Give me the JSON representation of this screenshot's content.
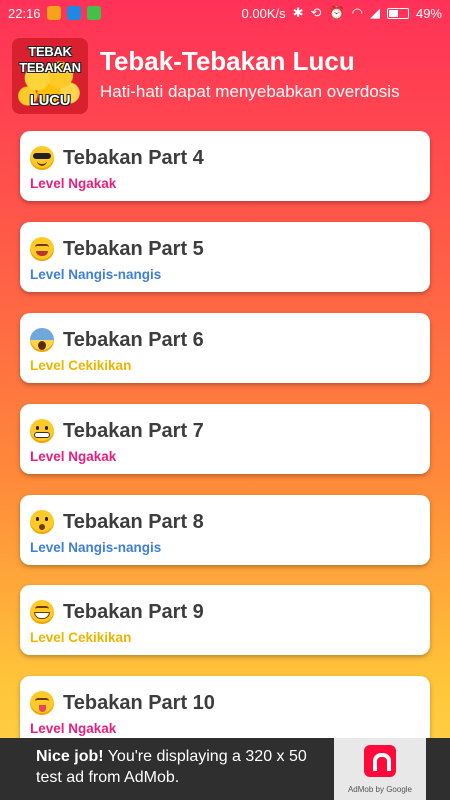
{
  "status_bar": {
    "time": "22:16",
    "speed": "0.00K/s",
    "battery": "49%",
    "left_icons": [
      "orange-app-icon",
      "shield-app-icon",
      "android-app-icon"
    ],
    "right_icons": [
      "bluetooth-icon",
      "sync-off-icon",
      "alarm-icon",
      "wifi-icon",
      "signal-icon",
      "battery-icon"
    ]
  },
  "header": {
    "logo_lines": [
      "TEBAK",
      "TEBAKAN",
      "LUCU"
    ],
    "title": "Tebak-Tebakan Lucu",
    "subtitle": "Hati-hati dapat menyebabkan overdosis"
  },
  "items": [
    {
      "title": "Tebakan Part 4",
      "level": "Level Ngakak",
      "level_color": "#e8207c",
      "emoji": "cool-face-icon"
    },
    {
      "title": "Tebakan Part 5",
      "level": "Level Nangis-nangis",
      "level_color": "#3f7fd9",
      "emoji": "smiling-face-icon"
    },
    {
      "title": "Tebakan Part 6",
      "level": "Level Cekikikan",
      "level_color": "#f0b400",
      "emoji": "screaming-face-icon"
    },
    {
      "title": "Tebakan Part 7",
      "level": "Level Ngakak",
      "level_color": "#e8207c",
      "emoji": "grimacing-face-icon"
    },
    {
      "title": "Tebakan Part 8",
      "level": "Level Nangis-nangis",
      "level_color": "#3f7fd9",
      "emoji": "surprised-face-icon"
    },
    {
      "title": "Tebakan Part 9",
      "level": "Level Cekikikan",
      "level_color": "#f0b400",
      "emoji": "grinning-face-icon"
    },
    {
      "title": "Tebakan Part 10",
      "level": "Level Ngakak",
      "level_color": "#e8207c",
      "emoji": "tongue-face-icon"
    }
  ],
  "ad": {
    "bold": "Nice job!",
    "text": " You're displaying a 320 x 50 test ad from AdMob.",
    "badge_caption": "AdMob by Google"
  }
}
